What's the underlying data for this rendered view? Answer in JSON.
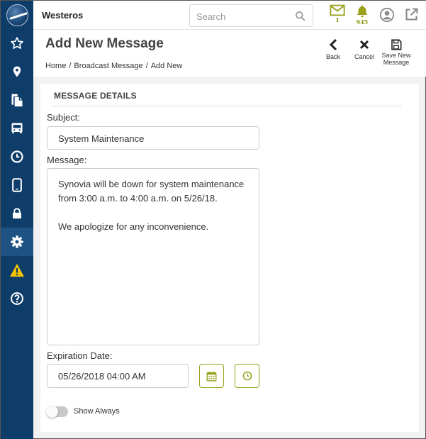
{
  "app": {
    "name": "Westeros"
  },
  "search": {
    "placeholder": "Search"
  },
  "notifications": {
    "messages_count": "1",
    "alerts_count": "945"
  },
  "colors": {
    "sidebar": "#0e3d6a",
    "accent": "#9aa01a",
    "alert_icon": "#f2c200"
  },
  "sidebar": {
    "items": [
      {
        "icon": "star-icon"
      },
      {
        "icon": "map-pin-icon"
      },
      {
        "icon": "documents-icon"
      },
      {
        "icon": "bus-icon"
      },
      {
        "icon": "clock-icon"
      },
      {
        "icon": "tablet-icon"
      },
      {
        "icon": "lock-icon"
      },
      {
        "icon": "gear-icon",
        "active": true
      },
      {
        "icon": "warning-icon"
      },
      {
        "icon": "help-icon"
      }
    ]
  },
  "page": {
    "title": "Add New Message",
    "breadcrumb": [
      "Home",
      "Broadcast Message",
      "Add New"
    ],
    "breadcrumb_separator": "/"
  },
  "actions": {
    "back": "Back",
    "cancel": "Cancel",
    "save_line1": "Save New",
    "save_line2": "Message"
  },
  "form": {
    "section_title": "MESSAGE DETAILS",
    "subject_label": "Subject:",
    "subject_value": "System Maintenance",
    "message_label": "Message:",
    "message_value": "Synovia will be down for system maintenance from 3:00 a.m. to 4:00 a.m. on 5/26/18.\n\nWe apologize for any inconvenience.",
    "expiration_label": "Expiration Date:",
    "expiration_value": "05/26/2018 04:00 AM",
    "show_always_label": "Show Always",
    "show_always": false
  }
}
